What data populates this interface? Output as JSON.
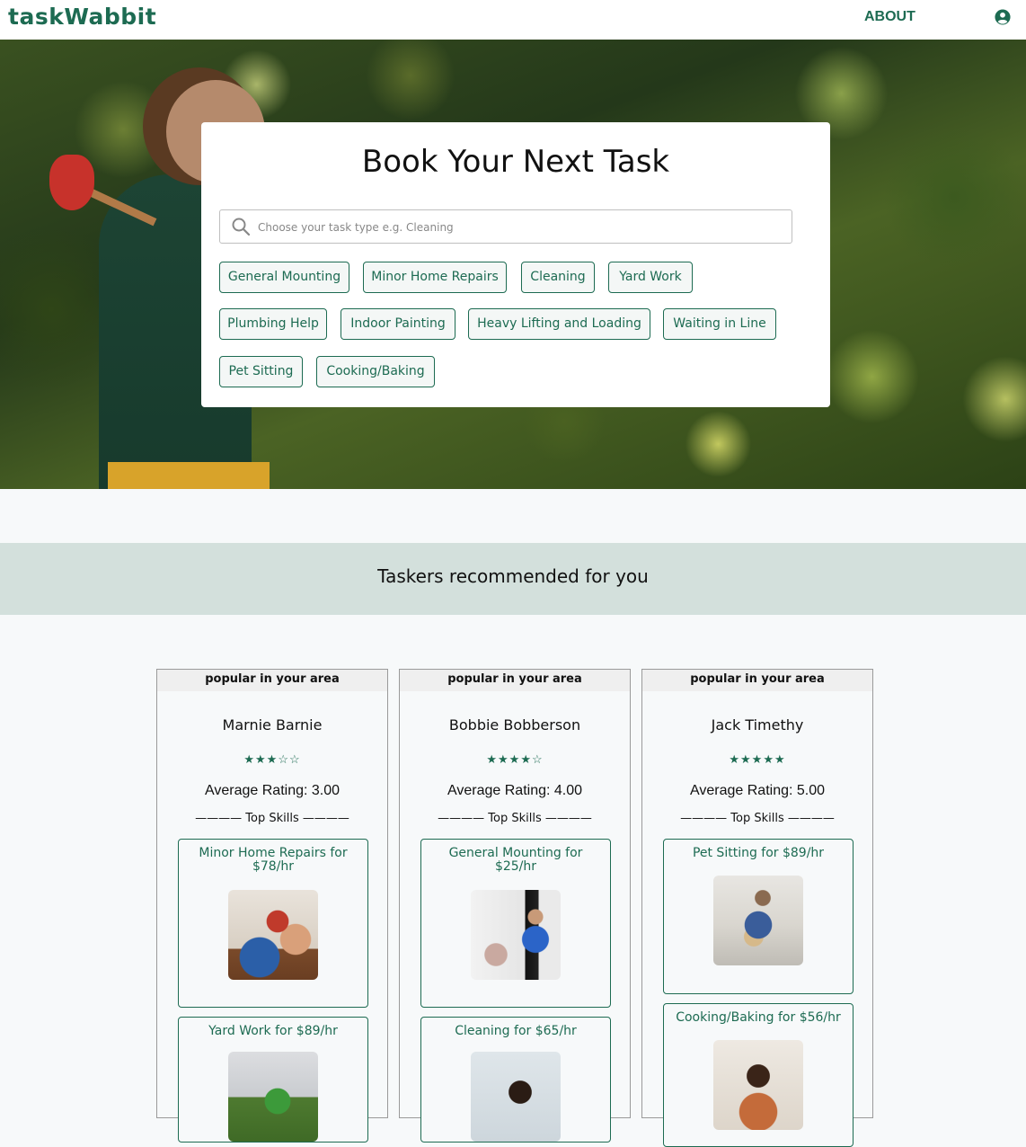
{
  "header": {
    "logo": "taskWabbit",
    "about_label": "ABOUT",
    "user_icon": "user-circle-icon"
  },
  "hero": {
    "title": "Book Your Next Task",
    "search": {
      "placeholder": "Choose your task type e.g. Cleaning",
      "value": ""
    },
    "categories": [
      "General Mounting",
      "Minor Home Repairs",
      "Cleaning",
      "Yard Work",
      "Plumbing Help",
      "Indoor Painting",
      "Heavy Lifting and Loading",
      "Waiting in Line",
      "Pet Sitting",
      "Cooking/Baking"
    ]
  },
  "recommended": {
    "title": "Taskers recommended for you",
    "taskers": [
      {
        "badge": "popular in your area",
        "name": "Marnie Barnie",
        "stars": "★★★☆☆",
        "average": "Average Rating: 3.00",
        "skills_heading": "———— Top Skills ————",
        "skills": [
          {
            "label": "Minor Home Repairs for $78/hr",
            "photo": "drilling-photo"
          },
          {
            "label": "Yard Work for $89/hr",
            "photo": "yard-work-photo"
          }
        ]
      },
      {
        "badge": "popular in your area",
        "name": "Bobbie Bobberson",
        "stars": "★★★★☆",
        "average": "Average Rating: 4.00",
        "skills_heading": "———— Top Skills ————",
        "skills": [
          {
            "label": "General Mounting for $25/hr",
            "photo": "tv-mounting-photo"
          },
          {
            "label": "Cleaning for $65/hr",
            "photo": "cleaning-photo"
          }
        ]
      },
      {
        "badge": "popular in your area",
        "name": "Jack Timethy",
        "stars": "★★★★★",
        "average": "Average Rating: 5.00",
        "skills_heading": "———— Top Skills ————",
        "skills": [
          {
            "label": "Pet Sitting for $89/hr",
            "photo": "pet-sitting-photo"
          },
          {
            "label": "Cooking/Baking for $56/hr",
            "photo": "cooking-photo"
          }
        ]
      }
    ]
  },
  "colors": {
    "brand": "#1d6b52",
    "banner": "#d3e0dc",
    "page_bg": "#f7f9fa"
  }
}
